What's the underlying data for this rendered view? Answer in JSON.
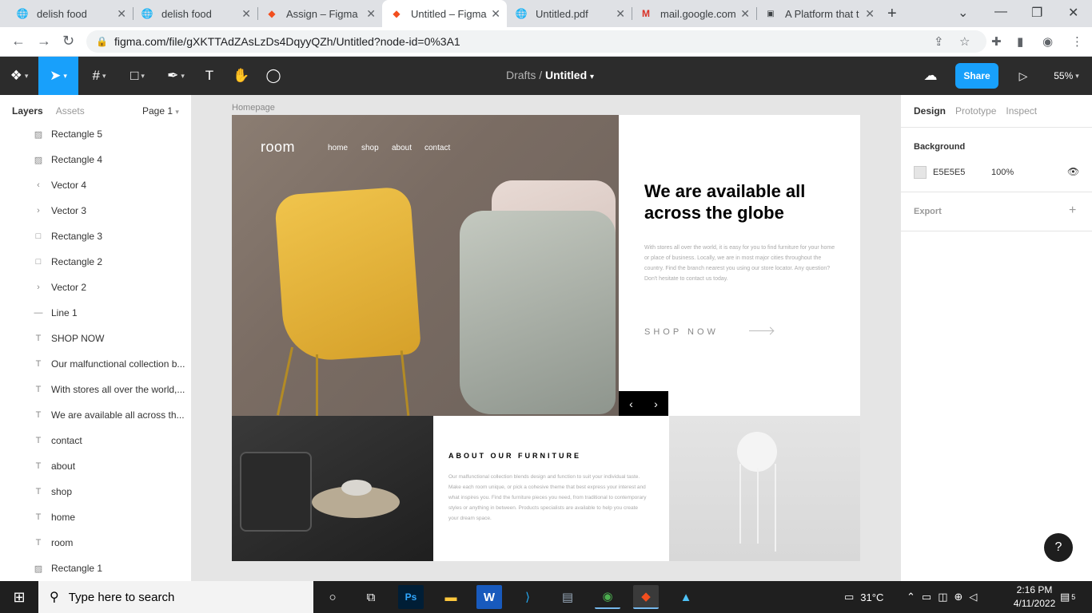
{
  "browser": {
    "tabs": [
      {
        "title": "delish food",
        "icon": "globe-icon"
      },
      {
        "title": "delish food",
        "icon": "globe-icon"
      },
      {
        "title": "Assign – Figma",
        "icon": "figma-icon"
      },
      {
        "title": "Untitled – Figma",
        "icon": "figma-icon"
      },
      {
        "title": "Untitled.pdf",
        "icon": "globe-icon"
      },
      {
        "title": "mail.google.com",
        "icon": "gmail-icon"
      },
      {
        "title": "A Platform that t",
        "icon": "outlook-icon"
      }
    ],
    "active_tab": 3,
    "url": "figma.com/file/gXKTTAdZAsLzDs4DqyyQZh/Untitled?node-id=0%3A1"
  },
  "figma": {
    "breadcrumb_parent": "Drafts",
    "file_name": "Untitled",
    "share_label": "Share",
    "zoom": "55%",
    "left_panel": {
      "tab_layers": "Layers",
      "tab_assets": "Assets",
      "page": "Page 1",
      "layers": [
        {
          "name": "Rectangle 5",
          "icon": "image"
        },
        {
          "name": "Rectangle 4",
          "icon": "image"
        },
        {
          "name": "Vector 4",
          "icon": "vector-left"
        },
        {
          "name": "Vector 3",
          "icon": "vector-right"
        },
        {
          "name": "Rectangle 3",
          "icon": "rect"
        },
        {
          "name": "Rectangle 2",
          "icon": "rect"
        },
        {
          "name": "Vector 2",
          "icon": "vector-right"
        },
        {
          "name": "Line 1",
          "icon": "line"
        },
        {
          "name": "SHOP NOW",
          "icon": "text"
        },
        {
          "name": "Our malfunctional collection b...",
          "icon": "text"
        },
        {
          "name": "With stores all over the world,...",
          "icon": "text"
        },
        {
          "name": "We are available all across th...",
          "icon": "text"
        },
        {
          "name": "contact",
          "icon": "text"
        },
        {
          "name": "about",
          "icon": "text"
        },
        {
          "name": "shop",
          "icon": "text"
        },
        {
          "name": "home",
          "icon": "text"
        },
        {
          "name": "room",
          "icon": "text"
        },
        {
          "name": "Rectangle 1",
          "icon": "image"
        }
      ]
    },
    "canvas": {
      "frame_label": "Homepage",
      "logo": "room",
      "nav": [
        "home",
        "shop",
        "about",
        "contact"
      ],
      "headline": "We are available all across the globe",
      "paragraph": "With stores all over the world, it is easy for you to find furniture for your home or place of business. Locally, we are in most major cities throughout the country. Find the branch nearest you using our store locator. Any question? Don't hesitate to contact us today.",
      "shop_now": "SHOP NOW",
      "about_title": "ABOUT OUR FURNITURE",
      "about_text": "Our malfunctional collection blends design and function to suit your individual taste. Make each room unique, or pick a cohesive theme that best express your interest and what inspires you. Find the furniture pieces you need, from traditional to contemporary styles or anything in between. Products specialists are available to help you create your dream space."
    },
    "right_panel": {
      "tab_design": "Design",
      "tab_prototype": "Prototype",
      "tab_inspect": "Inspect",
      "background_title": "Background",
      "background_hex": "E5E5E5",
      "background_opacity": "100%",
      "export_title": "Export"
    }
  },
  "taskbar": {
    "search_placeholder": "Type here to search",
    "temperature": "31°C",
    "time": "2:16 PM",
    "date": "4/11/2022",
    "notifications": "5"
  },
  "colors": {
    "figma_blue": "#18a0fb",
    "toolbar_bg": "#2c2c2c",
    "canvas_bg": "#e5e5e5"
  }
}
